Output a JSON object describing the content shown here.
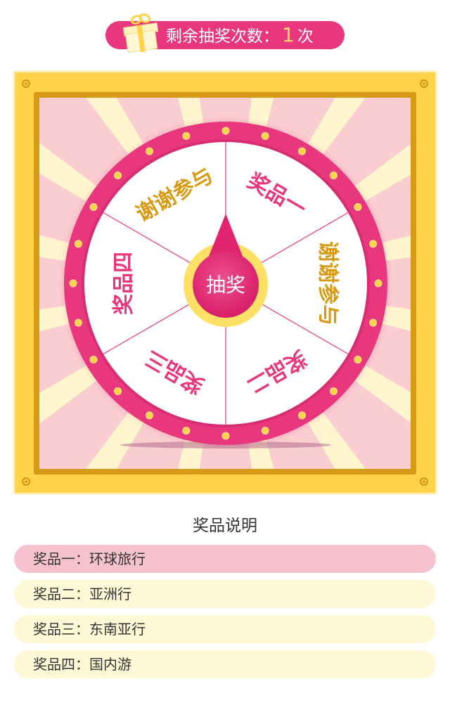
{
  "header": {
    "remaining_label": "剩余抽奖次数：",
    "remaining_count": "1",
    "remaining_unit": "次"
  },
  "wheel": {
    "segments": [
      {
        "label": "奖品一",
        "color": "#e8377d"
      },
      {
        "label": "谢谢参与",
        "color": "#d79a14"
      },
      {
        "label": "奖品二",
        "color": "#e8377d"
      },
      {
        "label": "奖品三",
        "color": "#e8377d"
      },
      {
        "label": "奖品四",
        "color": "#e8377d"
      },
      {
        "label": "谢谢参与",
        "color": "#d79a14"
      }
    ],
    "start_button_label": "抽奖"
  },
  "colors": {
    "accent": "#e8377d",
    "frame": "#ffd24a",
    "light_yellow": "#fff8d6",
    "light_pink": "#f7c2cf"
  },
  "prize_info": {
    "title": "奖品说明",
    "items": [
      {
        "label": "奖品一：环球旅行",
        "active": true
      },
      {
        "label": "奖品二：亚洲行",
        "active": false
      },
      {
        "label": "奖品三：东南亚行",
        "active": false
      },
      {
        "label": "奖品四：国内游",
        "active": false
      }
    ]
  },
  "icons": {
    "gift": "gift-icon",
    "pointer": "pointer-icon"
  }
}
